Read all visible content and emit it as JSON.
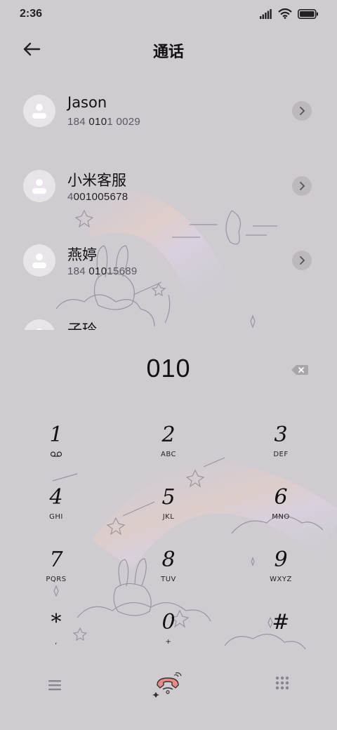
{
  "status_bar": {
    "time": "2:36",
    "icons": [
      "signal-icon",
      "wifi-icon",
      "battery-icon"
    ]
  },
  "header": {
    "title": "通话",
    "back_icon": "back-arrow-icon"
  },
  "contacts": [
    {
      "name": "Jason",
      "number_pre": "184 ",
      "number_match": "010",
      "number_post": "1 0029"
    },
    {
      "name": "小米客服",
      "number_pre": "4",
      "number_match": "001005678",
      "number_post": ""
    },
    {
      "name": "燕婷",
      "number_pre": "184 ",
      "number_match": "010",
      "number_post": "15689"
    },
    {
      "name": "子玲",
      "number_pre": "",
      "number_match": "",
      "number_post": ""
    }
  ],
  "dialer": {
    "dialed_number": "010",
    "backspace_icon": "backspace-icon"
  },
  "keypad": [
    {
      "digit": "1",
      "letters": "voicemail-icon"
    },
    {
      "digit": "2",
      "letters": "ABC"
    },
    {
      "digit": "3",
      "letters": "DEF"
    },
    {
      "digit": "4",
      "letters": "GHI"
    },
    {
      "digit": "5",
      "letters": "JKL"
    },
    {
      "digit": "6",
      "letters": "MNO"
    },
    {
      "digit": "7",
      "letters": "PQRS"
    },
    {
      "digit": "8",
      "letters": "TUV"
    },
    {
      "digit": "9",
      "letters": "WXYZ"
    },
    {
      "digit": "*",
      "letters": ","
    },
    {
      "digit": "0",
      "letters": "+"
    },
    {
      "digit": "#",
      "letters": ""
    }
  ],
  "bottom_bar": {
    "menu_icon": "menu-icon",
    "call_icon": "phone-call-icon",
    "keypad_icon": "dialpad-icon"
  },
  "colors": {
    "background": "#d0cbd1",
    "avatar_bg": "#e8e4e9",
    "call_accent": "#e88a8a"
  }
}
